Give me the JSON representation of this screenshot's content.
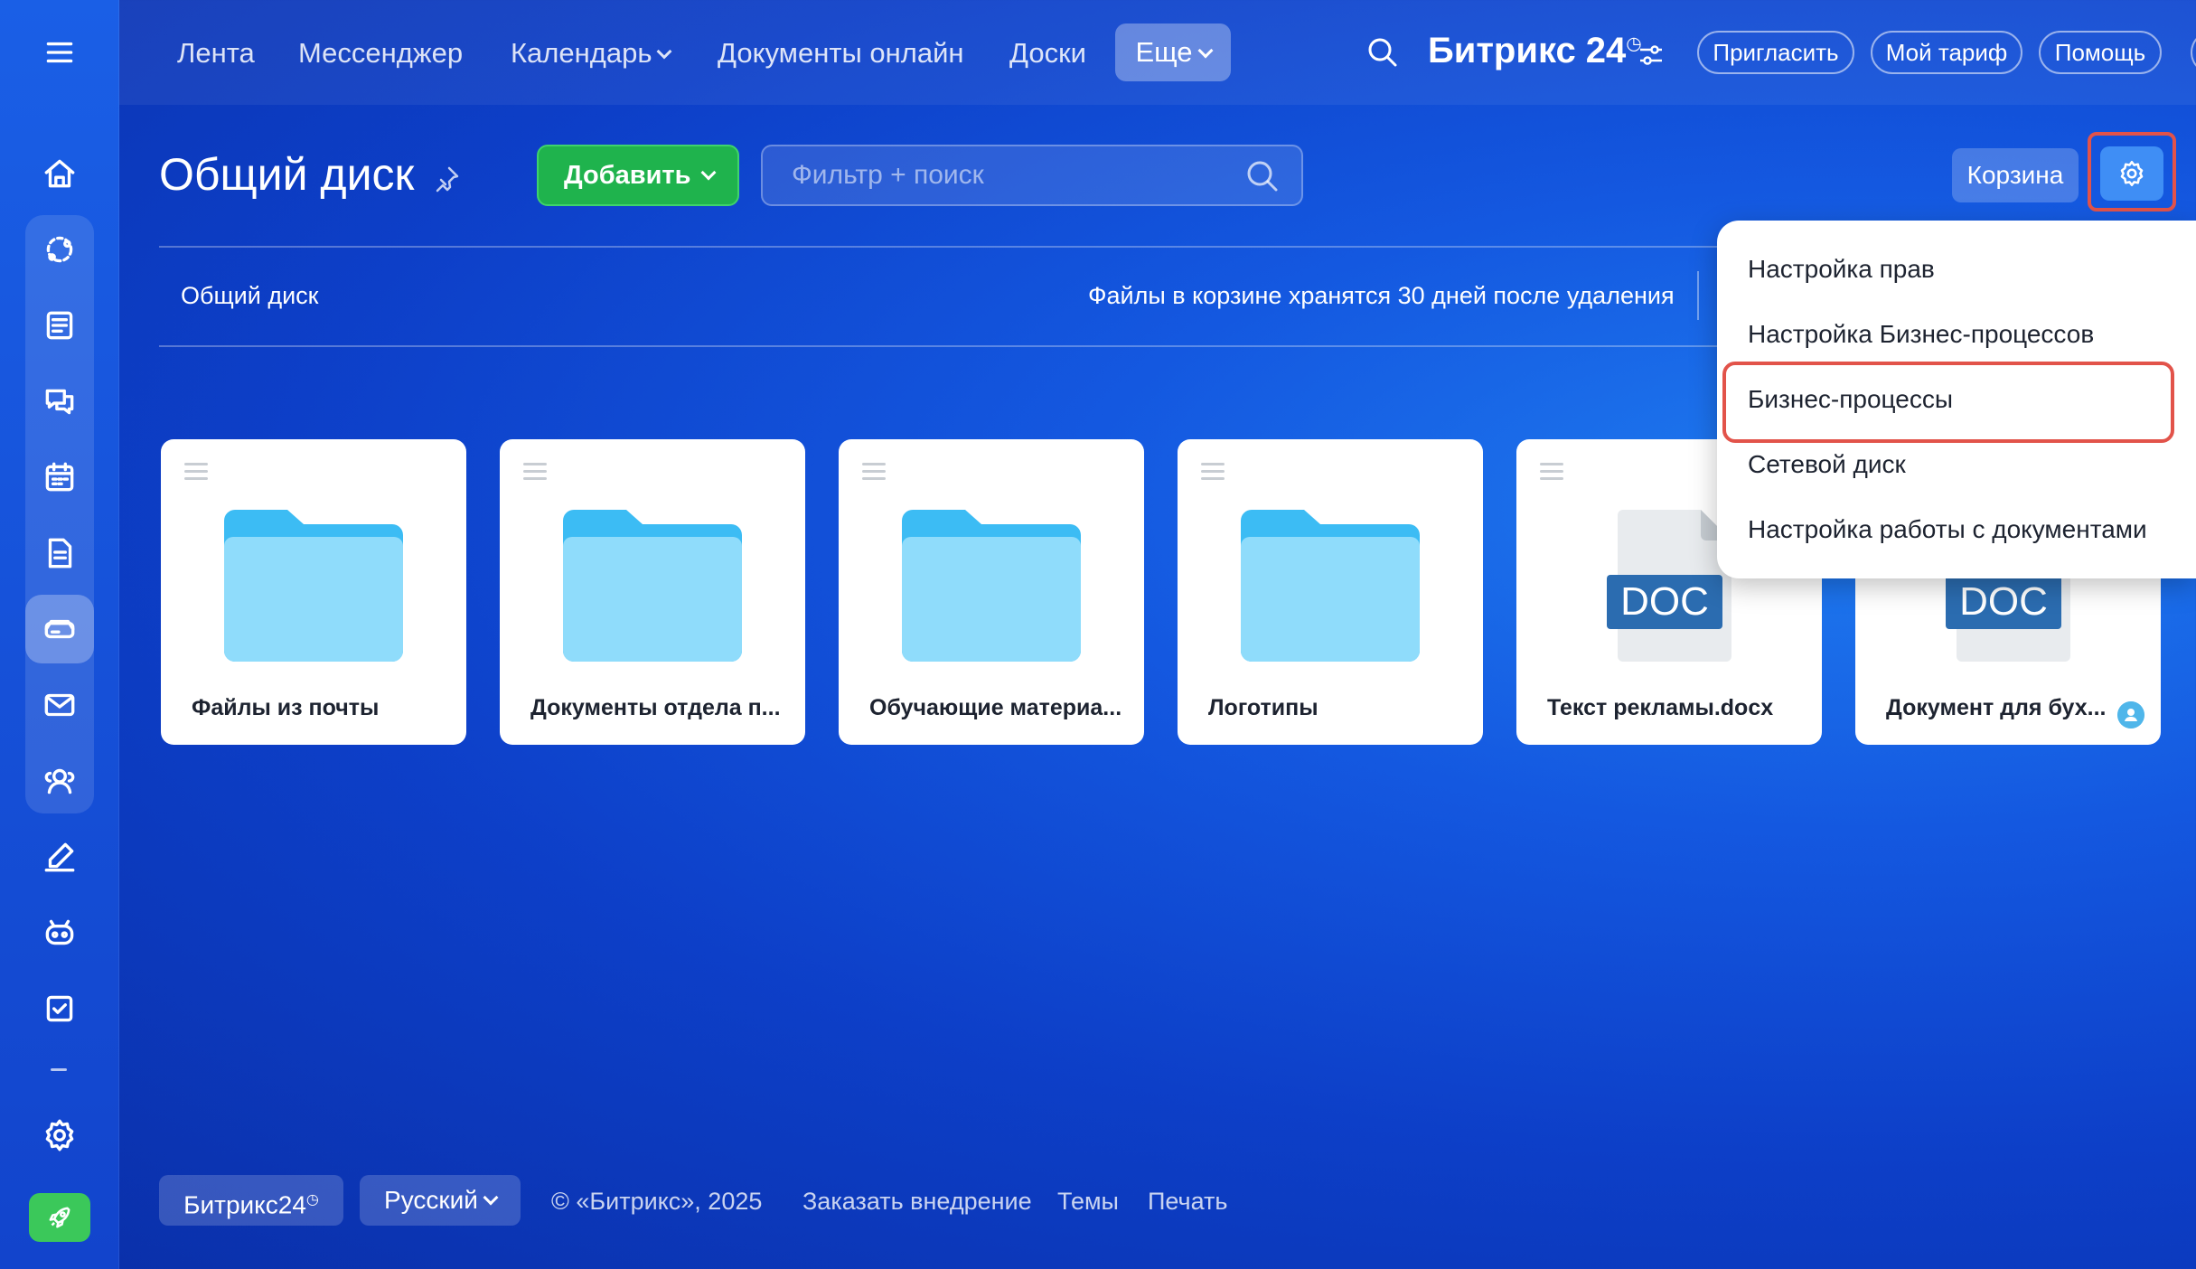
{
  "topnav": {
    "items": [
      {
        "label": "Лента"
      },
      {
        "label": "Мессенджер"
      },
      {
        "label": "Календарь"
      },
      {
        "label": "Документы онлайн"
      },
      {
        "label": "Доски"
      }
    ],
    "more_label": "Еще",
    "brand": "Битрикс 24",
    "brand_mark": "◷",
    "invite_label": "Пригласить",
    "plan_label": "Мой тариф",
    "help_label": "Помощь"
  },
  "header": {
    "title": "Общий диск",
    "add_label": "Добавить",
    "search_placeholder": "Фильтр + поиск",
    "trash_label": "Корзина"
  },
  "breadcrumb": {
    "root": "Общий диск",
    "trash_note": "Файлы в корзине хранятся 30 дней после удаления"
  },
  "tiles": [
    {
      "name": "Файлы из почты",
      "kind": "folder"
    },
    {
      "name": "Документы отдела п...",
      "kind": "folder"
    },
    {
      "name": "Обучающие материа...",
      "kind": "folder"
    },
    {
      "name": "Логотипы",
      "kind": "folder"
    },
    {
      "name": "Текст рекламы.docx",
      "kind": "doc",
      "badge": "DOC"
    },
    {
      "name": "Документ для бух...",
      "kind": "doc",
      "badge": "DOC",
      "shared": true
    }
  ],
  "settings_menu": {
    "items": [
      {
        "label": "Настройка прав"
      },
      {
        "label": "Настройка Бизнес-процессов"
      },
      {
        "label": "Бизнес-процессы"
      },
      {
        "label": "Сетевой диск"
      },
      {
        "label": "Настройка работы с документами"
      }
    ],
    "highlighted_index": 2
  },
  "footer": {
    "brand_label": "Битрикс24",
    "brand_mark": "◷",
    "language_label": "Русский",
    "copyright": "© «Битрикс», 2025",
    "order_link": "Заказать внедрение",
    "themes_link": "Темы",
    "print_link": "Печать"
  },
  "colors": {
    "accent_green": "#1fb34d",
    "highlight_red": "#e2534a",
    "folder_blue": "#8fdcfb",
    "folder_tab": "#3cbcf4",
    "doc_badge": "#2b6cb0"
  },
  "sidebar_icons": [
    "menu-icon",
    "home-icon",
    "sales-icon",
    "news-icon",
    "chat-icon",
    "calendar-icon",
    "document-icon",
    "disk-icon",
    "mail-icon",
    "contacts-icon",
    "sign-icon",
    "robot-icon",
    "tasks-icon",
    "settings-icon",
    "rocket-icon"
  ]
}
